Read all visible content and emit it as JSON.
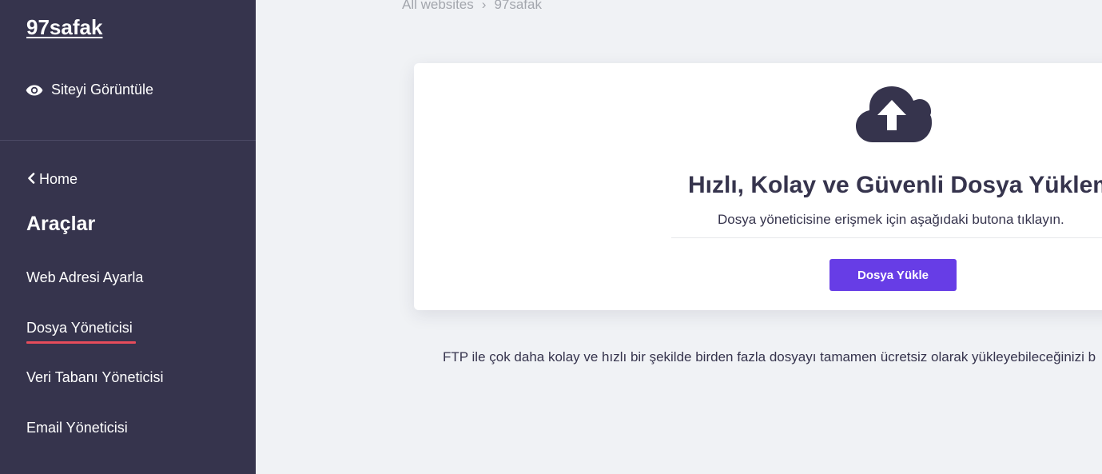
{
  "sidebar": {
    "site_name": "97safak",
    "view_site_label": "Siteyi Görüntüle",
    "home_label": "Home",
    "tools_heading": "Araçlar",
    "items": [
      {
        "label": "Web Adresi Ayarla",
        "active": false
      },
      {
        "label": "Dosya Yöneticisi",
        "active": true
      },
      {
        "label": "Veri Tabanı Yöneticisi",
        "active": false
      },
      {
        "label": "Email Yöneticisi",
        "active": false
      }
    ]
  },
  "breadcrumb": {
    "root": "All websites",
    "separator": "›",
    "current": "97safak"
  },
  "card": {
    "icon": "cloud-upload-icon",
    "title": "Hızlı, Kolay ve Güvenli Dosya Yükleme",
    "subtitle": "Dosya yöneticisine erişmek için aşağıdaki butona tıklayın.",
    "button_label": "Dosya Yükle"
  },
  "ftp_note": "FTP ile çok daha kolay ve hızlı bir şekilde birden fazla dosyayı tamamen ücretsiz olarak yükleyebileceğinizi b",
  "colors": {
    "sidebar_bg": "#36344d",
    "page_bg": "#f0f2f5",
    "accent": "#673de6",
    "active_underline": "#e74c5b",
    "text_dark": "#36344d"
  }
}
